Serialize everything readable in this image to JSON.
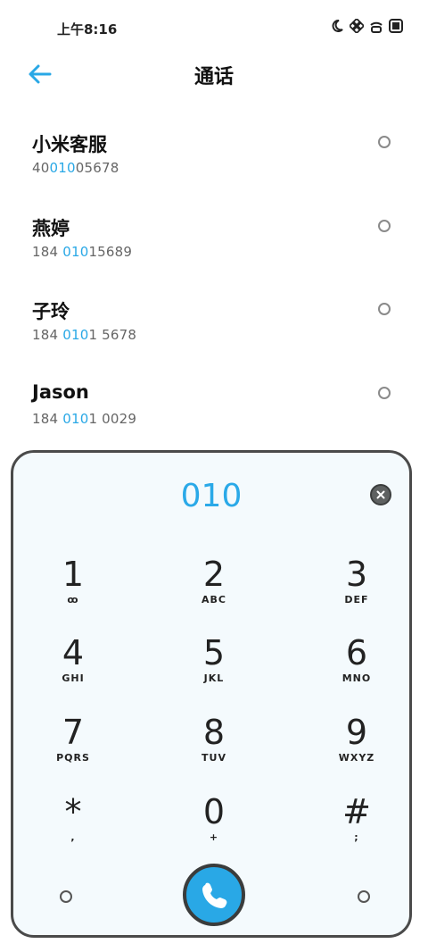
{
  "status_bar": {
    "time": "上午8:16",
    "icons": [
      "moon-icon",
      "grid-icon",
      "wifi-icon",
      "battery-icon"
    ]
  },
  "header": {
    "title": "通话",
    "back_icon": "arrow-left-icon"
  },
  "contacts": [
    {
      "name": "小米客服",
      "number_pre": "40",
      "number_match": "010",
      "number_post": "05678"
    },
    {
      "name": "燕婷",
      "number_pre": "184 ",
      "number_match": "010",
      "number_post": "15689"
    },
    {
      "name": "子玲",
      "number_pre": "184 ",
      "number_match": "010",
      "number_post": "1 5678"
    },
    {
      "name": "Jason",
      "number_pre": "184 ",
      "number_match": "010",
      "number_post": "1 0029"
    }
  ],
  "dialpad": {
    "display": "010",
    "keys": [
      {
        "digit": "1",
        "letters": "ꝏ"
      },
      {
        "digit": "2",
        "letters": "ABC"
      },
      {
        "digit": "3",
        "letters": "DEF"
      },
      {
        "digit": "4",
        "letters": "GHI"
      },
      {
        "digit": "5",
        "letters": "JKL"
      },
      {
        "digit": "6",
        "letters": "MNO"
      },
      {
        "digit": "7",
        "letters": "PQRS"
      },
      {
        "digit": "8",
        "letters": "TUV"
      },
      {
        "digit": "9",
        "letters": "WXYZ"
      },
      {
        "digit": "*",
        "letters": ","
      },
      {
        "digit": "0",
        "letters": "+"
      },
      {
        "digit": "#",
        "letters": ";"
      }
    ]
  },
  "colors": {
    "accent": "#29a8e6",
    "dialpad_bg": "#f4fafd"
  }
}
